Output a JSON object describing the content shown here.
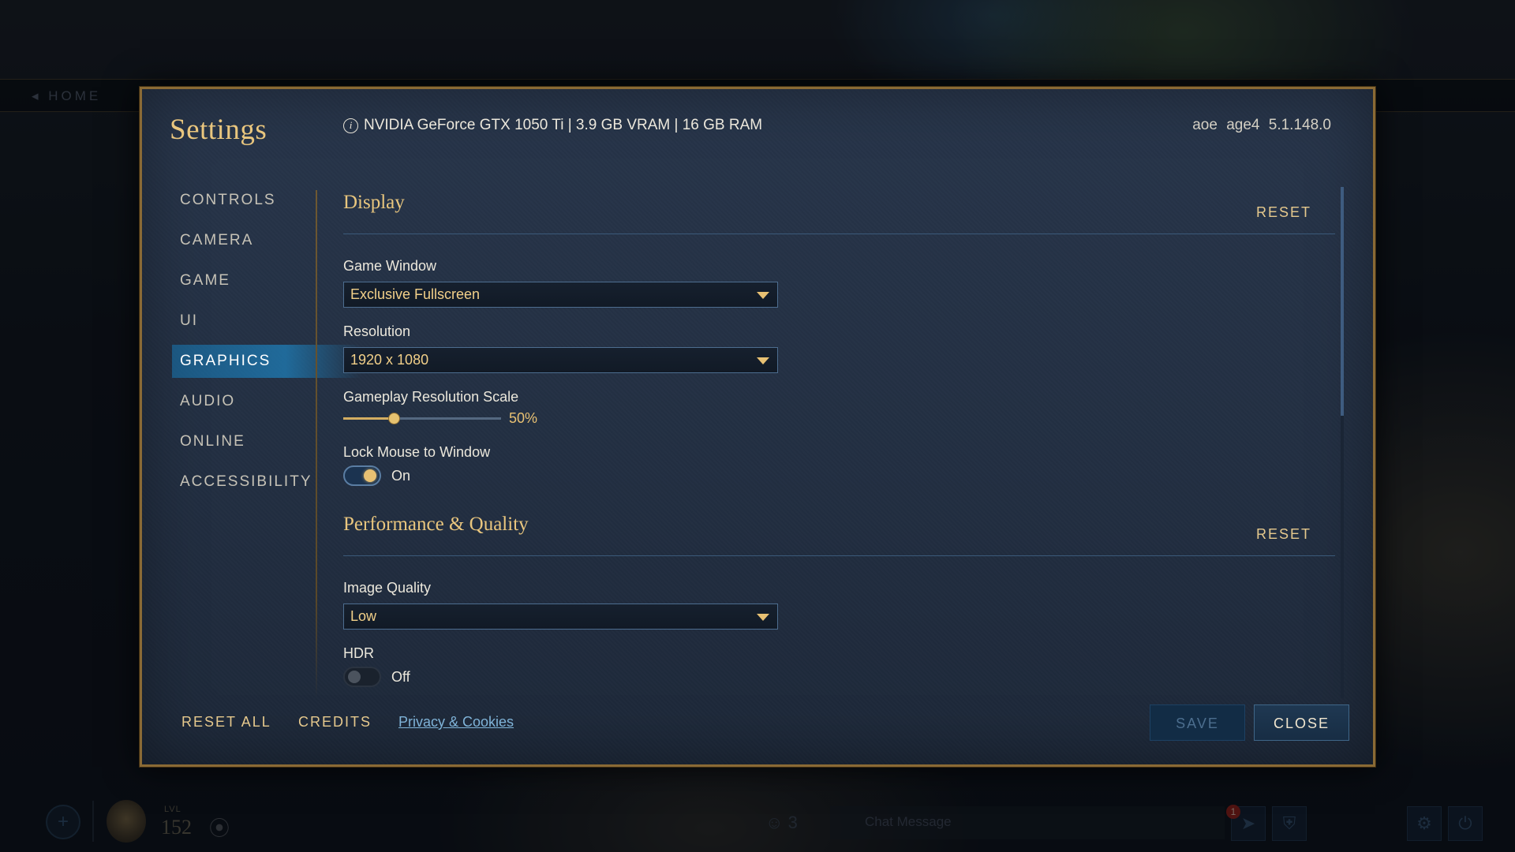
{
  "background": {
    "home_label": "◂ HOME",
    "level_label": "LVL",
    "level_value": "152",
    "people_count": "3",
    "chat_placeholder": "Chat Message",
    "notification_count": "1"
  },
  "modal": {
    "title": "Settings",
    "system_info": "NVIDIA GeForce GTX 1050 Ti | 3.9 GB VRAM | 16 GB RAM",
    "version": "aoe  age4  5.1.148.0"
  },
  "nav": {
    "items": [
      {
        "label": "CONTROLS"
      },
      {
        "label": "CAMERA"
      },
      {
        "label": "GAME"
      },
      {
        "label": "UI"
      },
      {
        "label": "GRAPHICS",
        "active": true
      },
      {
        "label": "AUDIO"
      },
      {
        "label": "ONLINE"
      },
      {
        "label": "ACCESSIBILITY"
      }
    ]
  },
  "display": {
    "title": "Display",
    "reset_label": "RESET",
    "game_window": {
      "label": "Game Window",
      "value": "Exclusive Fullscreen"
    },
    "resolution": {
      "label": "Resolution",
      "value": "1920 x 1080"
    },
    "resolution_scale": {
      "label": "Gameplay Resolution Scale",
      "value": 50,
      "value_text": "50%"
    },
    "lock_mouse": {
      "label": "Lock Mouse to Window",
      "state": "On"
    }
  },
  "performance": {
    "title": "Performance & Quality",
    "reset_label": "RESET",
    "image_quality": {
      "label": "Image Quality",
      "value": "Low"
    },
    "hdr": {
      "label": "HDR",
      "state": "Off"
    }
  },
  "footer": {
    "reset_all": "RESET ALL",
    "credits": "CREDITS",
    "privacy": "Privacy & Cookies",
    "save": "SAVE",
    "close": "CLOSE"
  },
  "colors": {
    "accent_gold": "#e9c67e",
    "active_nav_blue": "#1e82be",
    "modal_border": "#8a6a35"
  }
}
